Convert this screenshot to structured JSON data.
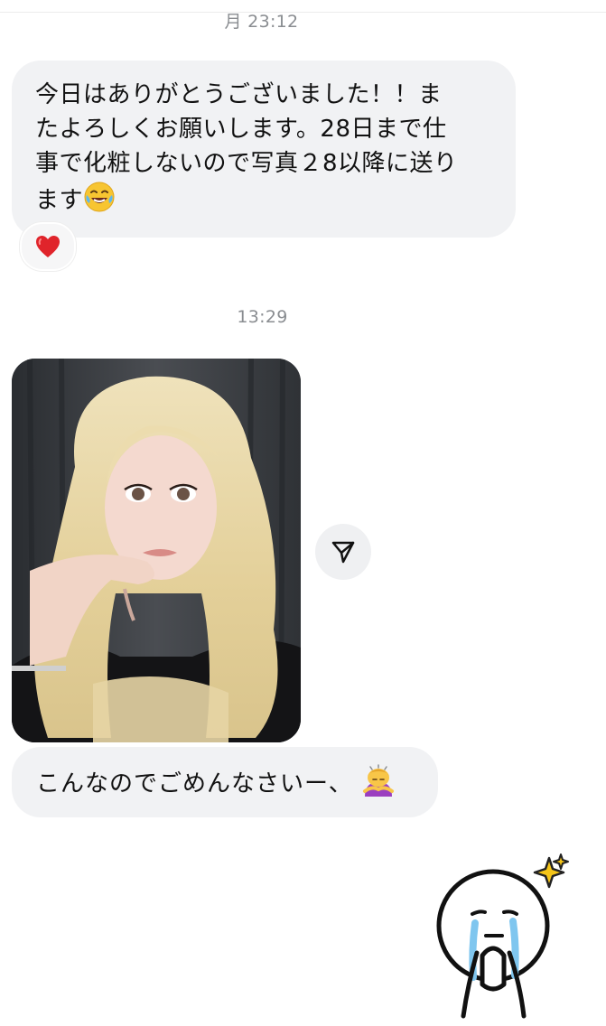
{
  "chat": {
    "timestamp_1": "月 23:12",
    "message_1": "今日はありがとうございました！！ま\nたよろしくお願いします。28日まで仕\n事で化粧しないので写真２8以降に送り\nます",
    "reaction": "heart",
    "timestamp_2": "13:29",
    "photo_icon": "photo-selfie",
    "message_2": "こんなのでごめんなさいー、",
    "message_2_emoji": "person-bowing-emoji",
    "share_icon": "send-icon",
    "sticker_icon": "crying-stick-figure-sticker"
  },
  "colors": {
    "bubble_bg": "#f1f2f4",
    "timestamp": "#8a8d91",
    "heart": "#e0242b",
    "hair": "#e9d7a6"
  }
}
